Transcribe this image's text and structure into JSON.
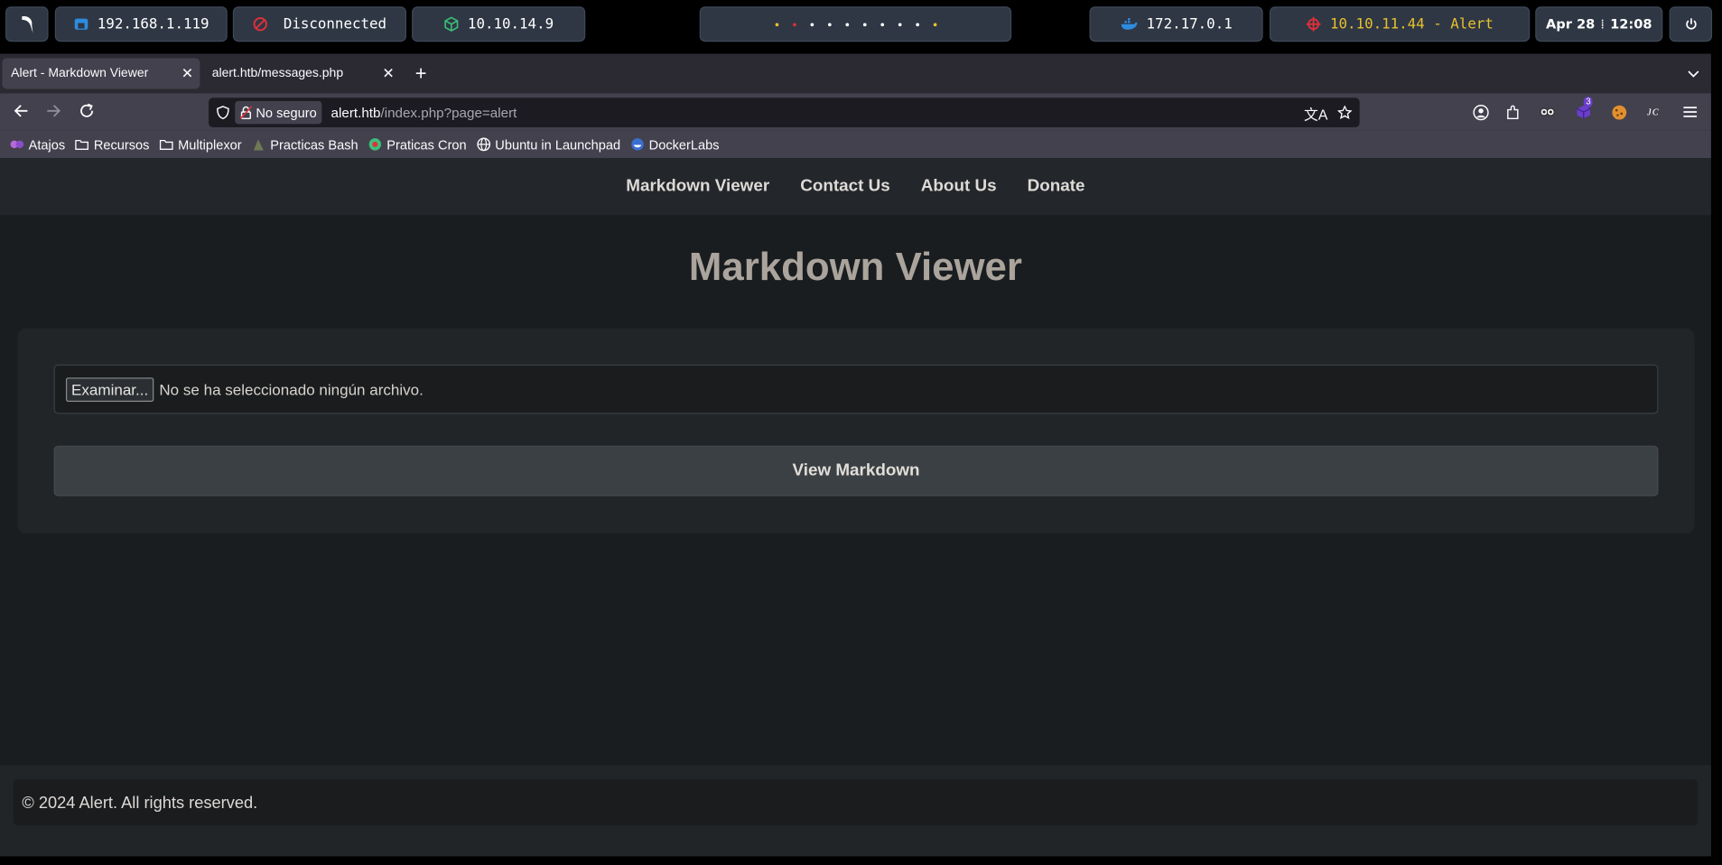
{
  "panel": {
    "local_ip": "192.168.1.119",
    "vpn_status": "Disconnected",
    "vpn_ip": "10.10.14.9",
    "docker_ip": "172.17.0.1",
    "target": "10.10.11.44 - Alert",
    "date": "Apr 28",
    "time": "12:08",
    "colors": {
      "vpn_red": "#e0303a",
      "target": "#e8c12e",
      "docker": "#2e8ce0",
      "vpn_ip_green": "#3cc07a"
    }
  },
  "browser": {
    "tabs": [
      {
        "title": "Alert - Markdown Viewer",
        "active": true
      },
      {
        "title": "alert.htb/messages.php",
        "active": false
      }
    ],
    "url": {
      "security_label": "No seguro",
      "host": "alert.htb",
      "path": "/index.php?page=alert"
    },
    "extension_badge": "3",
    "bookmarks": [
      {
        "label": "Atajos",
        "icon": "shortcuts-icon"
      },
      {
        "label": "Recursos",
        "icon": "folder-icon"
      },
      {
        "label": "Multiplexor",
        "icon": "folder-icon"
      },
      {
        "label": "Practicas Bash",
        "icon": "bash-icon"
      },
      {
        "label": "Praticas Cron",
        "icon": "cron-icon"
      },
      {
        "label": "Ubuntu in Launchpad",
        "icon": "globe-icon"
      },
      {
        "label": "DockerLabs",
        "icon": "dockerlabs-icon"
      }
    ]
  },
  "site": {
    "nav": [
      "Markdown Viewer",
      "Contact Us",
      "About Us",
      "Donate"
    ],
    "title": "Markdown Viewer",
    "browse_label": "Examinar...",
    "no_file_text": "No se ha seleccionado ningún archivo.",
    "submit_label": "View Markdown",
    "footer": "© 2024 Alert. All rights reserved."
  }
}
